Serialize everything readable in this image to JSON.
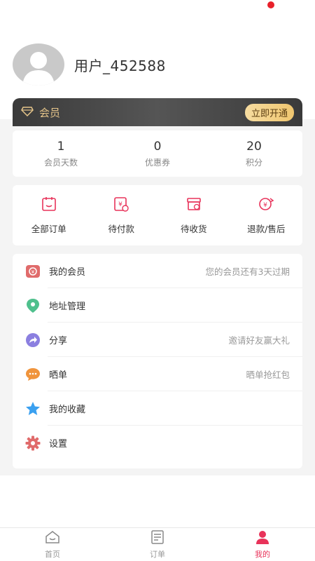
{
  "profile": {
    "username": "用户_452588"
  },
  "vip": {
    "label": "会员",
    "button": "立即开通"
  },
  "stats": [
    {
      "value": "1",
      "label": "会员天数"
    },
    {
      "value": "0",
      "label": "优惠券"
    },
    {
      "value": "20",
      "label": "积分"
    }
  ],
  "orders": [
    {
      "label": "全部订单",
      "icon": "all-orders-icon"
    },
    {
      "label": "待付款",
      "icon": "pending-payment-icon"
    },
    {
      "label": "待收货",
      "icon": "pending-receipt-icon"
    },
    {
      "label": "退款/售后",
      "icon": "refund-icon"
    }
  ],
  "menu": [
    {
      "label": "我的会员",
      "sub": "您的会员还有3天过期",
      "icon": "membership-icon",
      "color": "#e06b6b"
    },
    {
      "label": "地址管理",
      "sub": "",
      "icon": "location-icon",
      "color": "#4fc08d"
    },
    {
      "label": "分享",
      "sub": "邀请好友赢大礼",
      "icon": "share-icon",
      "color": "#8b7fe0"
    },
    {
      "label": "晒单",
      "sub": "晒单抢红包",
      "icon": "chat-icon",
      "color": "#f0943c"
    },
    {
      "label": "我的收藏",
      "sub": "",
      "icon": "star-icon",
      "color": "#3aa0f0"
    },
    {
      "label": "设置",
      "sub": "",
      "icon": "gear-icon",
      "color": "#e06b6b"
    }
  ],
  "tabs": [
    {
      "label": "首页",
      "icon": "home-icon",
      "active": false
    },
    {
      "label": "订单",
      "icon": "order-list-icon",
      "active": false
    },
    {
      "label": "我的",
      "icon": "user-icon",
      "active": true
    }
  ],
  "colors": {
    "accent": "#e8335a",
    "gold": "#e6c58a",
    "vip_bar": "#3a3a3a"
  }
}
